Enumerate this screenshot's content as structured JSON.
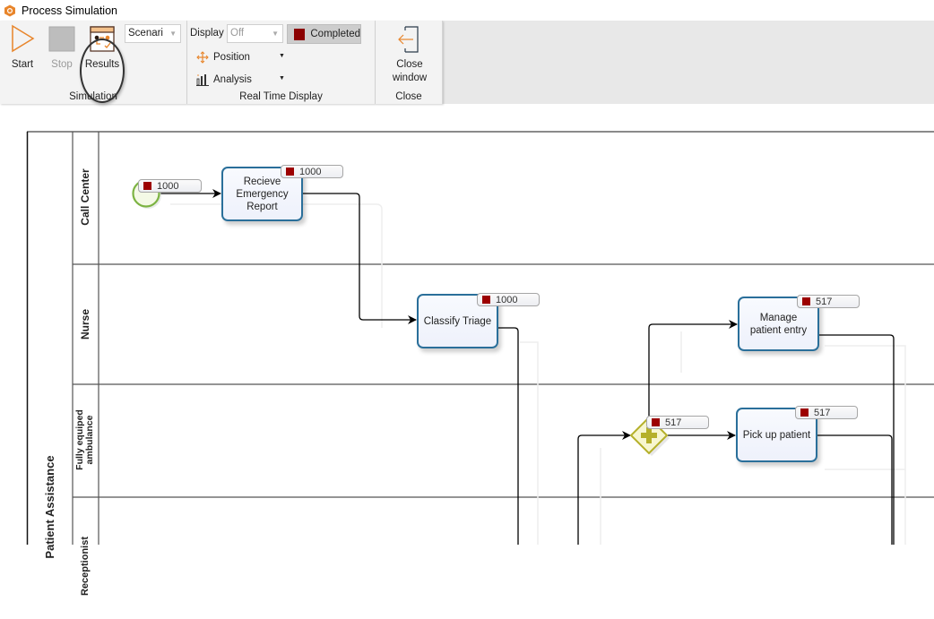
{
  "window": {
    "title": "Process Simulation",
    "app_icon": "hexagon-app-icon"
  },
  "ribbon": {
    "groups": {
      "simulation": {
        "label": "Simulation",
        "start_label": "Start",
        "stop_label": "Stop",
        "results_label": "Results",
        "scenario_value": "Scenari"
      },
      "real_time_display": {
        "label": "Real Time Display",
        "display_label": "Display",
        "display_value": "Off",
        "completed_label": "Completed",
        "completed_color": "#8b0000",
        "position_label": "Position",
        "analysis_label": "Analysis"
      },
      "close": {
        "label": "Close",
        "close_window_line1": "Close",
        "close_window_line2": "window"
      }
    }
  },
  "diagram": {
    "pool_label": "Patient Assistance",
    "lanes": [
      {
        "label": "Call Center"
      },
      {
        "label": "Nurse"
      },
      {
        "label_line1": "Fully equiped",
        "label_line2": "ambulance"
      },
      {
        "label": "Receptionist"
      }
    ],
    "elements": {
      "start_event": {
        "count": "1000"
      },
      "recieve_report": {
        "label_lines": [
          "Recieve",
          "Emergency",
          "Report"
        ],
        "count": "1000"
      },
      "classify_triage": {
        "label": "Classify Triage",
        "count": "1000"
      },
      "parallel_gateway": {
        "count": "517"
      },
      "manage_entry": {
        "label_lines": [
          "Manage",
          "patient entry"
        ],
        "count": "517"
      },
      "pick_up_patient": {
        "label": "Pick up patient",
        "count": "517"
      }
    },
    "colors": {
      "task_border": "#2a6f9a",
      "badge_marker": "#9c0000",
      "start_event": "#7cb342",
      "gateway": "#b5b02a"
    }
  }
}
